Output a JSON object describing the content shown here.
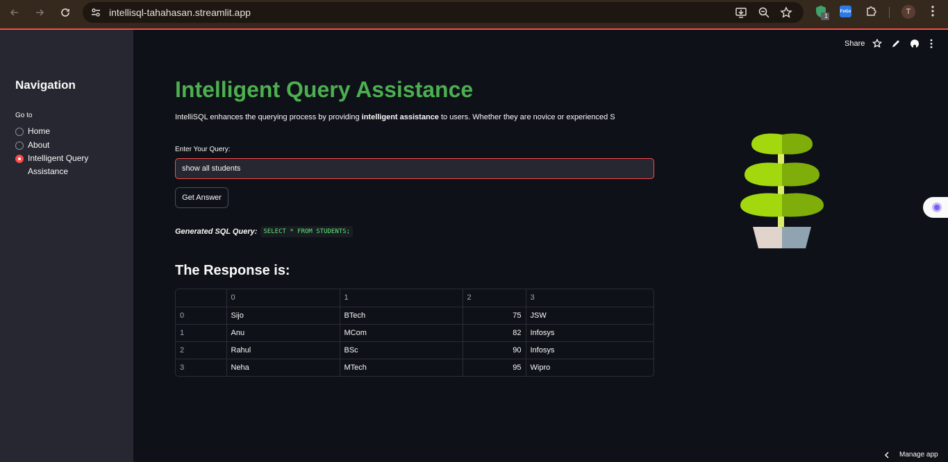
{
  "browser": {
    "url": "intellisql-tahahasan.streamlit.app",
    "profile_initial": "T",
    "extension_badge": "1",
    "extension_label": "FoGo"
  },
  "sidebar": {
    "title": "Navigation",
    "goto_label": "Go to",
    "items": [
      {
        "label": "Home",
        "selected": false
      },
      {
        "label": "About",
        "selected": false
      },
      {
        "label": "Intelligent Query Assistance",
        "selected": true
      }
    ]
  },
  "toolbar": {
    "share_label": "Share"
  },
  "main": {
    "title": "Intelligent Query Assistance",
    "intro_prefix": "IntelliSQL enhances the querying process by providing ",
    "intro_bold": "intelligent assistance",
    "intro_suffix": " to users. Whether they are novice or experienced S",
    "query_label": "Enter Your Query:",
    "query_value": "show all students",
    "button_label": "Get Answer",
    "sql_label": "Generated SQL Query:",
    "sql_code": "SELECT * FROM STUDENTS;",
    "response_title": "The Response is:"
  },
  "table": {
    "columns": [
      "",
      "0",
      "1",
      "2",
      "3"
    ],
    "rows": [
      [
        "0",
        "Sijo",
        "BTech",
        "75",
        "JSW"
      ],
      [
        "1",
        "Anu",
        "MCom",
        "82",
        "Infosys"
      ],
      [
        "2",
        "Rahul",
        "BSc",
        "90",
        "Infosys"
      ],
      [
        "3",
        "Neha",
        "MTech",
        "95",
        "Wipro"
      ]
    ]
  },
  "footer": {
    "manage_label": "Manage app"
  },
  "colors": {
    "accent": "#ff4b4b",
    "title_green": "#4caf50",
    "code_green": "#5ee675"
  }
}
